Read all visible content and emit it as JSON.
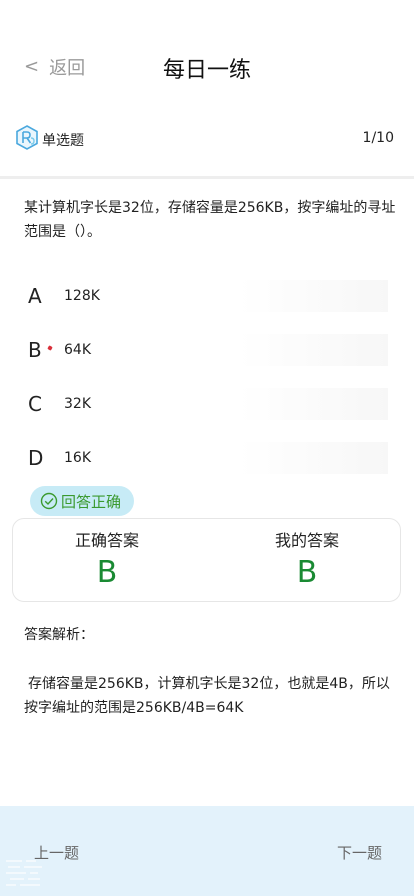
{
  "header": {
    "back_label": "返回",
    "title": "每日一练"
  },
  "question_meta": {
    "type_label": "单选题",
    "progress": "1/10"
  },
  "question": {
    "text": "某计算机字长是32位，存储容量是256KB，按字编址的寻址范围是（）。"
  },
  "options": [
    {
      "letter": "A",
      "text": "128K"
    },
    {
      "letter": "B",
      "text": "64K"
    },
    {
      "letter": "C",
      "text": "32K"
    },
    {
      "letter": "D",
      "text": "16K"
    }
  ],
  "result": {
    "label": "回答正确",
    "color": "#3b9a2f"
  },
  "answers": {
    "correct_label": "正确答案",
    "correct_value": "B",
    "mine_label": "我的答案",
    "mine_value": "B",
    "value_color": "#1a8a33"
  },
  "analysis": {
    "title": "答案解析：",
    "text": "存储容量是256KB，计算机字长是32位，也就是4B，所以按字编址的范围是256KB/4B=64K"
  },
  "footer": {
    "prev_label": "上一题",
    "next_label": "下一题",
    "background": "#e3f2fb"
  }
}
